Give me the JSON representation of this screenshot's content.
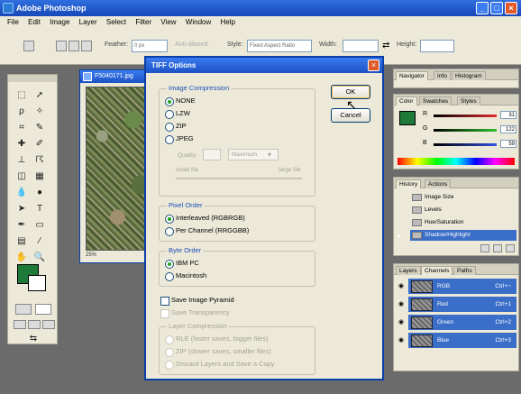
{
  "app": {
    "title": "Adobe Photoshop"
  },
  "menu": [
    "File",
    "Edit",
    "Image",
    "Layer",
    "Select",
    "Filter",
    "View",
    "Window",
    "Help"
  ],
  "options_bar": {
    "feather_label": "Feather:",
    "feather_value": "0 px",
    "antialiased_label": "Anti-aliased",
    "style_label": "Style:",
    "style_value": "Fixed Aspect Ratio",
    "width_label": "Width:",
    "height_label": "Height:"
  },
  "document": {
    "title": "F5040171.jpg",
    "zoom": "25%"
  },
  "dialog": {
    "title": "TIFF Options",
    "ok": "OK",
    "cancel": "Cancel",
    "image_compression": {
      "label": "Image Compression",
      "options": [
        "NONE",
        "LZW",
        "ZIP",
        "JPEG"
      ],
      "selected": "NONE",
      "quality_label": "Quality:",
      "quality_select": "Maximum",
      "small_file": "small file",
      "large_file": "large file"
    },
    "pixel_order": {
      "label": "Pixel Order",
      "options": [
        "Interleaved (RGBRGB)",
        "Per Channel (RRGGBB)"
      ],
      "selected": "Interleaved (RGBRGB)"
    },
    "byte_order": {
      "label": "Byte Order",
      "options": [
        "IBM PC",
        "Macintosh"
      ],
      "selected": "IBM PC"
    },
    "save_image_pyramid": "Save Image Pyramid",
    "save_transparency": "Save Transparency",
    "layer_compression": {
      "label": "Layer Compression",
      "options": [
        "RLE (faster saves, bigger files)",
        "ZIP (slower saves, smaller files)",
        "Discard Layers and Save a Copy"
      ]
    }
  },
  "navigator_panel": {
    "tabs": [
      "Navigator",
      "Info",
      "Histogram"
    ]
  },
  "color_panel": {
    "tabs": [
      "Color",
      "Swatches",
      "Styles"
    ],
    "channels": [
      {
        "label": "R",
        "value": "31",
        "color": "#e03030"
      },
      {
        "label": "G",
        "value": "122",
        "color": "#30c030"
      },
      {
        "label": "B",
        "value": "59",
        "color": "#3050e0"
      }
    ]
  },
  "history_panel": {
    "tabs": [
      "History",
      "Actions"
    ],
    "items": [
      "Image Size",
      "Levels",
      "Hue/Saturation",
      "Shadow/Highlight"
    ],
    "selected": "Shadow/Highlight"
  },
  "channels_panel": {
    "tabs": [
      "Layers",
      "Channels",
      "Paths"
    ],
    "channels": [
      {
        "name": "RGB",
        "shortcut": "Ctrl+~"
      },
      {
        "name": "Red",
        "shortcut": "Ctrl+1"
      },
      {
        "name": "Green",
        "shortcut": "Ctrl+2"
      },
      {
        "name": "Blue",
        "shortcut": "Ctrl+3"
      }
    ]
  },
  "colors": {
    "titlebar": "#1c52c4",
    "foreground": "#1f7a3a",
    "selection": "#3a6ec8"
  }
}
